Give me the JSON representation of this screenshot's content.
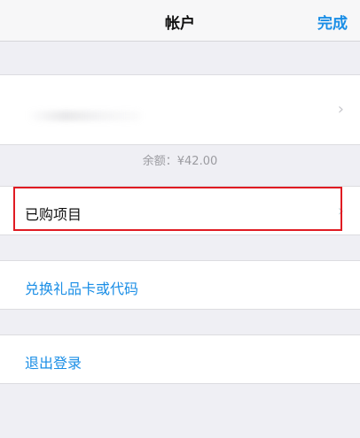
{
  "nav": {
    "title": "帐户",
    "done_label": "完成"
  },
  "account": {
    "masked_name": ""
  },
  "balance_text": "余额：¥42.00",
  "menu": {
    "purchased_label": "已购项目",
    "redeem_label": "兑换礼品卡或代码",
    "signout_label": "退出登录"
  },
  "icons": {
    "chevron": "chevron-right-icon"
  },
  "colors": {
    "accent": "#1a8ee6",
    "highlight": "#e01b22",
    "background": "#efeff4"
  }
}
